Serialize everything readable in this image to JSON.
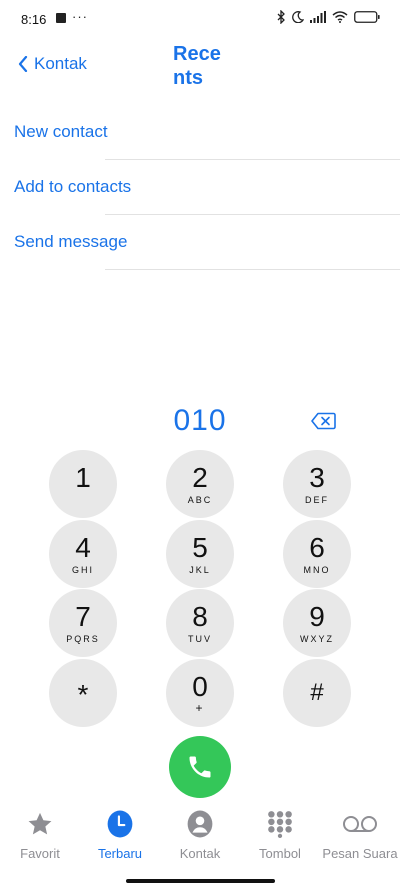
{
  "status_bar": {
    "time": "8:16",
    "dots": "···"
  },
  "nav": {
    "back_label": "Kontak",
    "title": "Recents"
  },
  "menu": [
    {
      "label": "New contact"
    },
    {
      "label": "Add to contacts"
    },
    {
      "label": "Send message"
    }
  ],
  "dialer": {
    "number": "010",
    "keys": [
      {
        "digit": "1",
        "letters": ""
      },
      {
        "digit": "2",
        "letters": "ABC"
      },
      {
        "digit": "3",
        "letters": "DEF"
      },
      {
        "digit": "4",
        "letters": "GHI"
      },
      {
        "digit": "5",
        "letters": "JKL"
      },
      {
        "digit": "6",
        "letters": "MNO"
      },
      {
        "digit": "7",
        "letters": "PQRS"
      },
      {
        "digit": "8",
        "letters": "TUV"
      },
      {
        "digit": "9",
        "letters": "WXYZ"
      },
      {
        "digit": "*",
        "letters": ""
      },
      {
        "digit": "0",
        "letters": "+"
      },
      {
        "digit": "#",
        "letters": ""
      }
    ]
  },
  "tabs": [
    {
      "label": "Favorit",
      "icon": "star-icon"
    },
    {
      "label": "Terbaru",
      "icon": "clock-icon",
      "active": true
    },
    {
      "label": "Kontak",
      "icon": "person-icon"
    },
    {
      "label": "Tombol",
      "icon": "keypad-icon"
    },
    {
      "label": "Pesan Suara",
      "icon": "voicemail-icon"
    }
  ],
  "colors": {
    "accent": "#1a73e8",
    "call": "#34c759",
    "key_bg": "#e8e8e8",
    "inactive": "#8e8e93"
  }
}
